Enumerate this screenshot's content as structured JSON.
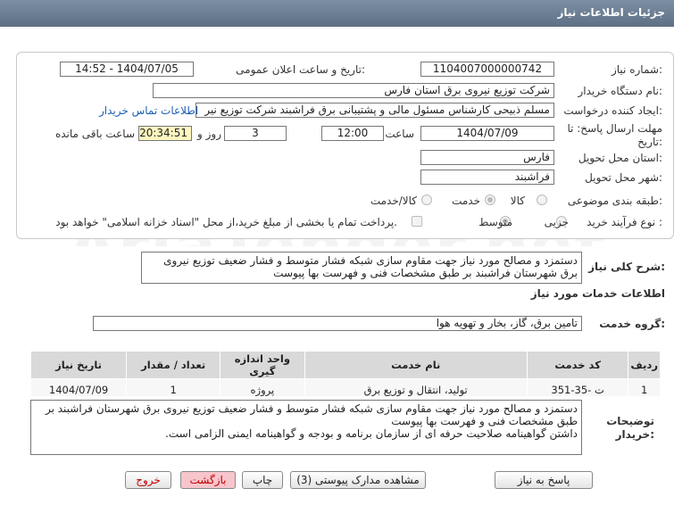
{
  "header": {
    "title": "جزئیات اطلاعات نیاز"
  },
  "form": {
    "need_number_label": "شماره نیاز:",
    "need_number": "1104007000000742",
    "announce_label": "تاریخ و ساعت اعلان عمومی:",
    "announce_value": "1404/07/05 - 14:52",
    "buyer_label": "نام دستگاه خریدار:",
    "buyer_value": "شرکت توزیع نیروی برق استان فارس",
    "creator_label": "ایجاد کننده درخواست:",
    "creator_value": "مسلم ذبیحی کارشناس مسئول مالی و پشتیبانی برق فراشبند شرکت توزیع نیر",
    "contact_link": "اطلاعات تماس خریدار",
    "deadline_label": "مهلت ارسال پاسخ: تا",
    "deadline_label2": "تاریخ:",
    "deadline_date": "1404/07/09",
    "time_label": "ساعت",
    "deadline_time": "12:00",
    "days_value": "3",
    "days_label": "روز و",
    "remaining_time": "20:34:51",
    "remaining_label": "ساعت باقی مانده",
    "province_label": "استان محل تحویل:",
    "province_value": "فارس",
    "city_label": "شهر محل تحویل:",
    "city_value": "فراشبند",
    "category_label": "طبقه بندی موضوعی:",
    "category_options": [
      "کالا",
      "خدمت",
      "کالا/خدمت"
    ],
    "category_selected": "خدمت",
    "process_label": "نوع فرآیند خرید :",
    "process_options": [
      "جزیی",
      "متوسط"
    ],
    "process_selected": "متوسط",
    "payment_note": "پرداخت تمام یا بخشی از مبلغ خرید،از محل \"اسناد خزانه اسلامی\" خواهد بود."
  },
  "summary": {
    "label": "شرح کلی نیاز:",
    "text": "دستمزد و مصالح مورد نیاز جهت مقاوم سازی شبکه فشار متوسط و فشار ضعیف توزیع نیروی برق شهرستان فراشبند بر طبق مشخصات فنی و فهرست بها پیوست",
    "services_title": "اطلاعات خدمات مورد نیاز",
    "group_label": "گروه خدمت:",
    "group_value": "تامین برق، گاز، بخار و تهویه هوا"
  },
  "table": {
    "headers": [
      "ردیف",
      "کد خدمت",
      "نام خدمت",
      "واحد اندازه گیری",
      "تعداد / مقدار",
      "تاریخ نیاز"
    ],
    "rows": [
      [
        "1",
        "ت -35-351",
        "تولید، انتقال و توزیع برق",
        "پروژه",
        "1",
        "1404/07/09"
      ]
    ]
  },
  "buyer_notes": {
    "label1": "توضیحات",
    "label2": "خریدار:",
    "text": "دستمزد و مصالح مورد نیاز جهت مقاوم سازی شبکه فشار متوسط و فشار ضعیف توزیع نیروی برق شهرستان فراشبند بر طبق مشخصات فنی و فهرست بها پیوست\nداشتن گواهینامه صلاحیت حرفه ای از سازمان برنامه و بودجه و گواهینامه ایمنی الزامی است."
  },
  "buttons": {
    "reply": "پاسخ به نیاز",
    "docs": "مشاهده مدارک پیوستی (3)",
    "print": "چاپ",
    "back": "بازگشت",
    "exit": "خروج"
  },
  "watermark": "AriaTender.net"
}
